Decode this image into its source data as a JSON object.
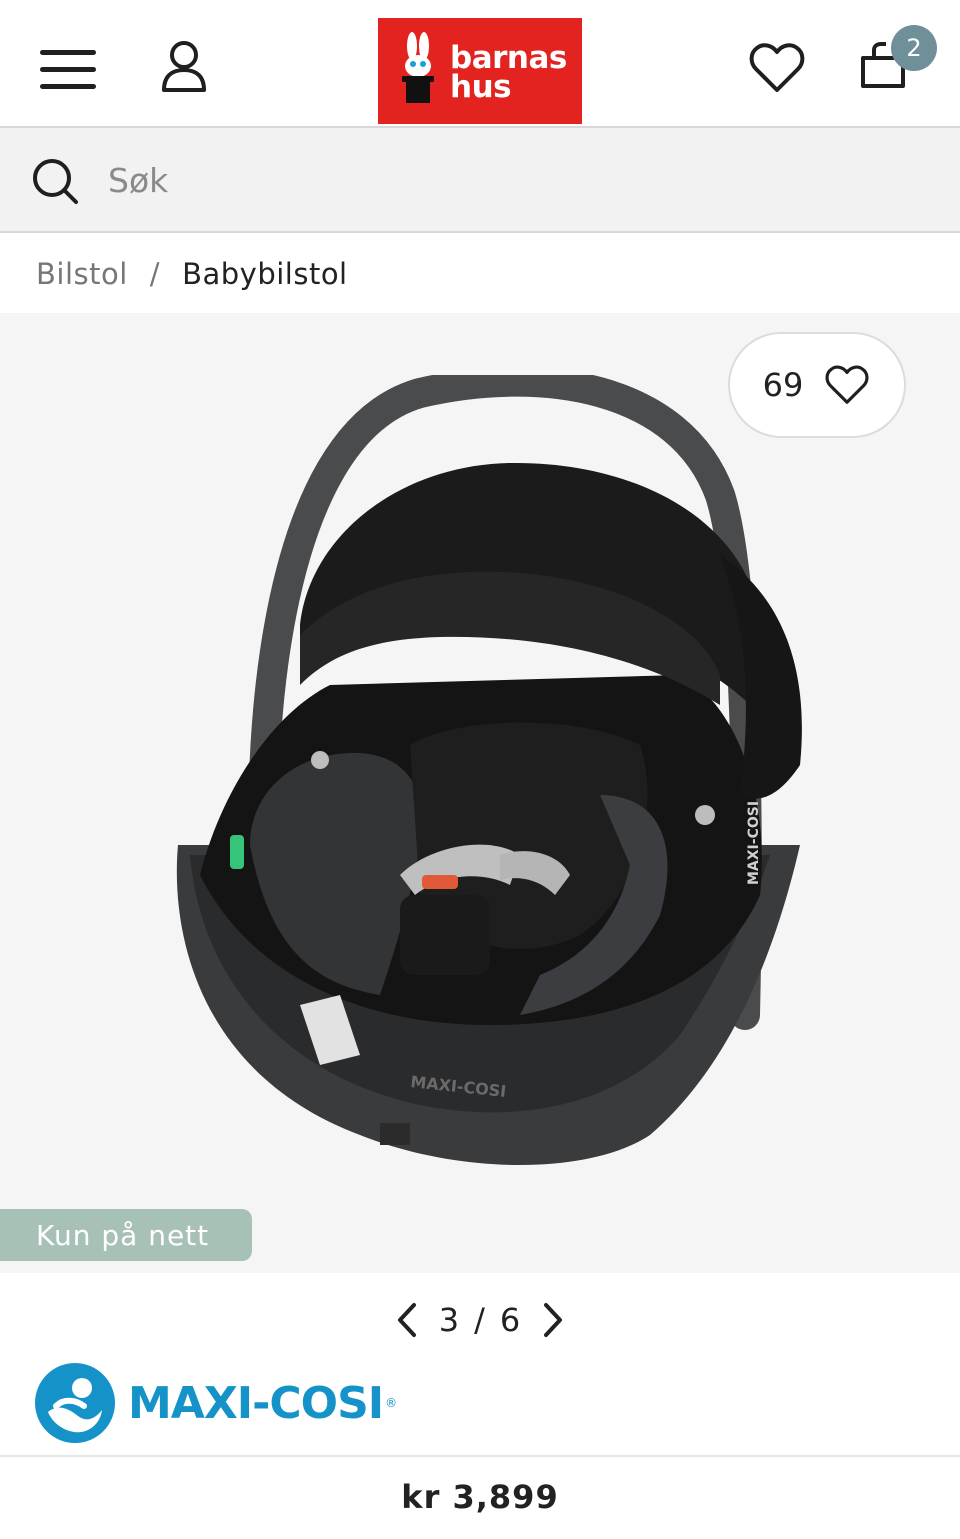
{
  "header": {
    "logo_line1": "barnas",
    "logo_line2": "hus",
    "cart_count": "2",
    "icons": [
      "menu-icon",
      "user-icon",
      "heart-icon",
      "cart-icon"
    ]
  },
  "search": {
    "placeholder": "Søk"
  },
  "breadcrumb": {
    "items": [
      {
        "label": "Bilstol"
      },
      {
        "label": "Babybilstol"
      }
    ],
    "separator": "/"
  },
  "product": {
    "favorite_count": "69",
    "badge": "Kun på nett",
    "image": {
      "brand_text_base": "MAXI-COSI",
      "brand_text_handle": "MAXI-COSI"
    },
    "pager": {
      "current": "3",
      "separator": "/",
      "total": "6"
    },
    "brand": "MAXI-COSI",
    "brand_reg": "®",
    "price": "kr 3,899"
  },
  "colors": {
    "brand_red": "#e3231f",
    "badge_green": "#a7c1b7",
    "cart_badge": "#6f8f99",
    "maxi_cosi_blue": "#1593c9"
  }
}
